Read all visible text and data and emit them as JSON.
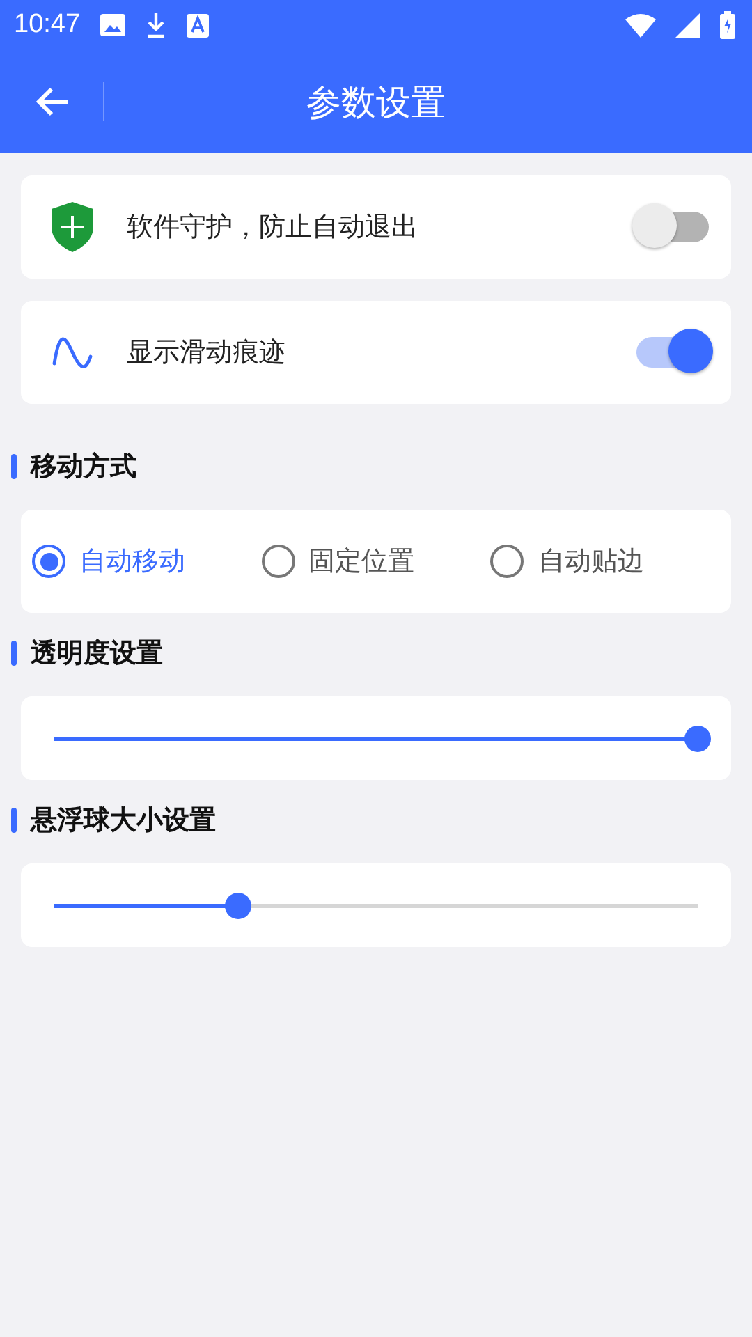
{
  "status_bar": {
    "time": "10:47"
  },
  "header": {
    "title": "参数设置"
  },
  "toggles": [
    {
      "kind": "shield",
      "label": "软件守护，防止自动退出",
      "on": false
    },
    {
      "kind": "wave",
      "label": "显示滑动痕迹",
      "on": true
    }
  ],
  "move_mode": {
    "title": "移动方式",
    "options": [
      {
        "label": "自动移动",
        "selected": true
      },
      {
        "label": "固定位置",
        "selected": false
      },
      {
        "label": "自动贴边",
        "selected": false
      }
    ]
  },
  "sliders": [
    {
      "title": "透明度设置",
      "level": 1
    },
    {
      "title": "悬浮球大小设置",
      "level": 0.286
    }
  ]
}
